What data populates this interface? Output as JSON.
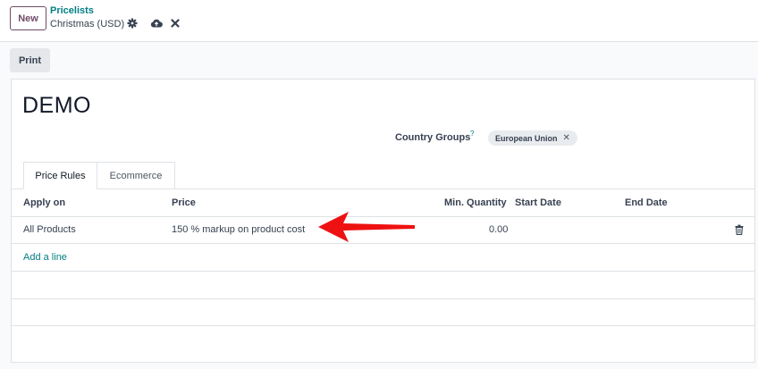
{
  "control_panel": {
    "new_label": "New",
    "breadcrumb_parent": "Pricelists",
    "breadcrumb_current": "Christmas (USD)"
  },
  "status_bar": {
    "print_label": "Print"
  },
  "form": {
    "title": "DEMO",
    "country_groups_label": "Country Groups",
    "country_groups_help": "?",
    "country_group_tags": [
      "European Union"
    ]
  },
  "tabs": [
    {
      "label": "Price Rules",
      "active": true
    },
    {
      "label": "Ecommerce",
      "active": false
    }
  ],
  "table": {
    "headers": [
      "Apply on",
      "Price",
      "Min. Quantity",
      "Start Date",
      "End Date"
    ],
    "rows": [
      {
        "apply_on": "All Products",
        "price": "150 % markup on product cost",
        "min_quantity": "0.00",
        "start_date": "",
        "end_date": ""
      }
    ],
    "add_line_label": "Add a line"
  },
  "colors": {
    "brand": "#714B67",
    "link": "#017e84",
    "arrow": "#ee1111"
  }
}
